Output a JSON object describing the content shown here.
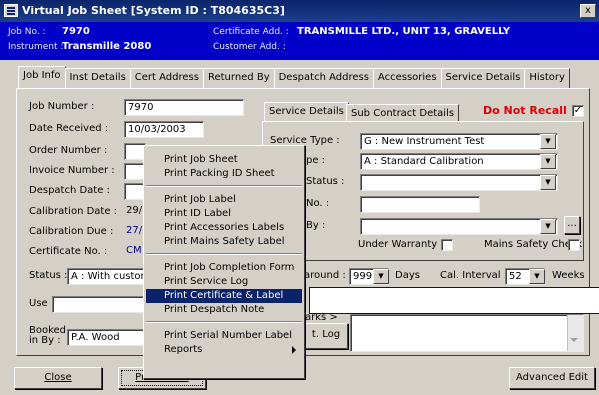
{
  "window": {
    "title": "Virtual Job Sheet [System ID : T804635C3]",
    "close_glyph": "x"
  },
  "header": {
    "job_no_label": "Job No. :",
    "job_no": "7970",
    "instrument_label": "Instrument :",
    "instrument": "Transmille 2080",
    "cert_address_label": "Certificate Add. :",
    "cert_address": "TRANSMILLE LTD., UNIT 13, GRAVELLY",
    "customer_address_label": "Customer Add. :"
  },
  "tabs": [
    "Job Info",
    "Inst Details",
    "Cert Address",
    "Returned By",
    "Despatch Address",
    "Accessories",
    "Service Details",
    "History"
  ],
  "job_info": {
    "job_number_label": "Job Number :",
    "job_number": "7970",
    "date_received_label": "Date Received :",
    "date_received": "10/03/2003",
    "order_number_label": "Order Number :",
    "invoice_number_label": "Invoice Number :",
    "despatch_date_label": "Despatch Date :",
    "calibration_date_label": "Calibration Date :",
    "calibration_date": "29/",
    "calibration_due_label": "Calibration Due :",
    "calibration_due": "27/",
    "certificate_no_label": "Certificate No. :",
    "certificate_no": "CM",
    "status_label": "Status :",
    "status": "A : With custom",
    "use_label": "Use :",
    "booked_in_label_1": "Booked",
    "booked_in_label_2": "in By :",
    "booked_in_by": "P.A. Wood"
  },
  "service": {
    "tab_service_details": "Service Details",
    "tab_sub_contract": "Sub Contract Details",
    "do_not_recall_label": "Do Not Recall",
    "do_not_recall_checked": "✓",
    "service_type_label": "Service Type :",
    "service_type": "G : New Instrument Test",
    "type_label_partial": "pe :",
    "type_value": "A : Standard Calibration",
    "status_label_partial": "Status :",
    "no_label_partial": "No. :",
    "by_label_partial": "By :",
    "ellipsis": "...",
    "under_warranty_label": "Under Warranty",
    "mains_safety_label": "Mains Safety Check",
    "turnaround_label_partial": "around :",
    "turnaround": "999",
    "days_label": "Days",
    "cal_interval_label": "Cal. Interval :",
    "cal_interval": "52",
    "weeks_label": "Weeks",
    "remarks_partial": "arks >",
    "log_button": "t. Log"
  },
  "context_menu": {
    "items": [
      "Print Job Sheet",
      "Print Packing ID Sheet",
      "Print Job Label",
      "Print ID Label",
      "Print Accessories Labels",
      "Print Mains Safety Label",
      "Print Job Completion Form",
      "Print Service Log",
      "Print Certificate & Label",
      "Print Despatch Note",
      "Print Serial Number Label",
      "Reports"
    ],
    "highlighted": "Print Certificate & Label"
  },
  "buttons": {
    "close": "Close",
    "print_menu": "Print Menu",
    "advanced_edit": "Advanced Edit"
  },
  "colors": {
    "titlebar": "#0a246a",
    "header_band": "#0000c8",
    "do_not_recall": "#e00000",
    "value_blue": "#000080",
    "menu_highlight": "#0a246a"
  }
}
